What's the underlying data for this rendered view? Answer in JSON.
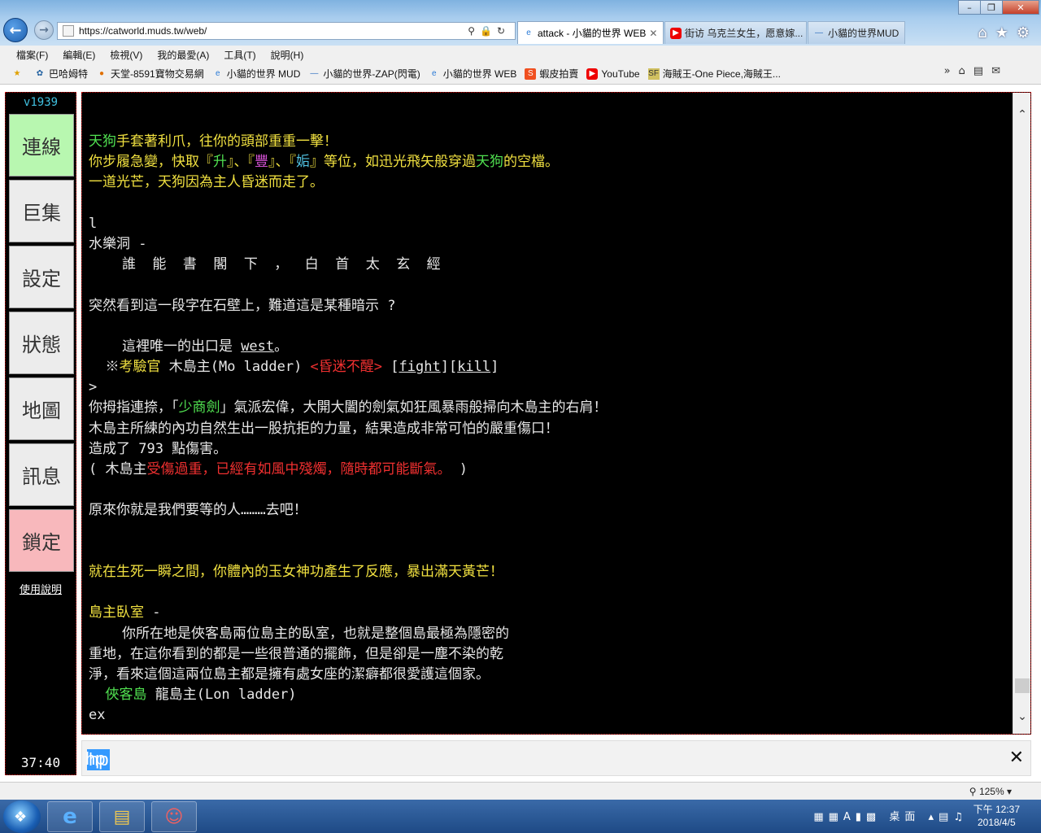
{
  "browser": {
    "url": "https://catworld.muds.tw/web/",
    "tabs": [
      {
        "label": "attack - 小貓的世界 WEB",
        "active": true
      },
      {
        "label": "街访 乌克兰女生，愿意嫁...",
        "active": false
      },
      {
        "label": "小貓的世界MUD",
        "active": false
      }
    ],
    "menu": [
      "檔案(F)",
      "編輯(E)",
      "檢視(V)",
      "我的最愛(A)",
      "工具(T)",
      "說明(H)"
    ],
    "favorites": [
      "巴哈姆特",
      "天堂-8591寶物交易網",
      "小貓的世界 MUD",
      "小貓的世界-ZAP(閃電)",
      "小貓的世界 WEB",
      "蝦皮拍賣",
      "YouTube",
      "海賊王-One Piece,海賊王..."
    ],
    "zoom": "125%"
  },
  "sidebar": {
    "version": "v1939",
    "buttons": [
      "連線",
      "巨集",
      "設定",
      "狀態",
      "地圖",
      "訊息",
      "鎖定"
    ],
    "help": "使用說明",
    "clock": "37:40"
  },
  "terminal": {
    "lines": [
      [
        {
          "t": "天狗",
          "c": "g"
        },
        {
          "t": "手套著利爪，往你的頭部重重一擊！",
          "c": "y"
        }
      ],
      [
        {
          "t": "你步履急變，快取『",
          "c": "y"
        },
        {
          "t": "升",
          "c": "g"
        },
        {
          "t": "』、『",
          "c": "y"
        },
        {
          "t": "豐",
          "c": "m"
        },
        {
          "t": "』、『",
          "c": "y"
        },
        {
          "t": "姤",
          "c": "c"
        },
        {
          "t": "』等位，如迅光飛矢般穿過",
          "c": "y"
        },
        {
          "t": "天狗",
          "c": "g"
        },
        {
          "t": "的空檔。",
          "c": "y"
        }
      ],
      [
        {
          "t": "一道光芒，天狗因為主人昏迷而走了。",
          "c": "y"
        }
      ],
      [],
      [
        {
          "t": "l",
          "c": "w"
        }
      ],
      [
        {
          "t": "水樂洞 -",
          "c": "w"
        }
      ],
      [
        {
          "t": "    誰  能  書  閣  下  ，  白  首  太  玄  經",
          "c": "w"
        }
      ],
      [],
      [
        {
          "t": "突然看到這一段字在石壁上，難道這是某種暗示 ?",
          "c": "w"
        }
      ],
      [],
      [
        {
          "t": "    這裡唯一的出口是 ",
          "c": "w"
        },
        {
          "t": "west",
          "c": "w",
          "u": true
        },
        {
          "t": "。",
          "c": "w"
        }
      ],
      [
        {
          "t": "  ※",
          "c": "w"
        },
        {
          "t": "考驗官",
          "c": "y"
        },
        {
          "t": " 木島主(Mo ladder) ",
          "c": "w"
        },
        {
          "t": "<昏迷不醒>",
          "c": "r"
        },
        {
          "t": " [",
          "c": "w"
        },
        {
          "t": "fight",
          "c": "w",
          "u": true
        },
        {
          "t": "][",
          "c": "w"
        },
        {
          "t": "kill",
          "c": "w",
          "u": true
        },
        {
          "t": "]",
          "c": "w"
        }
      ],
      [
        {
          "t": ">",
          "c": "w"
        }
      ],
      [
        {
          "t": "你拇指連捺，「",
          "c": "w"
        },
        {
          "t": "少商劍",
          "c": "g"
        },
        {
          "t": "」氣派宏偉，大開大闔的劍氣如狂風暴雨般掃向木島主的右肩！",
          "c": "w"
        }
      ],
      [
        {
          "t": "木島主所練的內功自然生出一股抗拒的力量，結果造成非常可怕的嚴重傷口！",
          "c": "w"
        }
      ],
      [
        {
          "t": "造成了 793 點傷害。",
          "c": "w"
        }
      ],
      [
        {
          "t": "( 木島主",
          "c": "w"
        },
        {
          "t": "受傷過重，已經有如風中殘燭，隨時都可能斷氣。",
          "c": "r"
        },
        {
          "t": " )",
          "c": "w"
        }
      ],
      [],
      [
        {
          "t": "原來你就是我們要等的人………去吧！",
          "c": "w"
        }
      ],
      [],
      [],
      [
        {
          "t": "就在生死一瞬之間，你體內的玉女神功產生了反應，暴出滿天黃芒！",
          "c": "y"
        }
      ],
      [],
      [
        {
          "t": "島主臥室",
          "c": "y"
        },
        {
          "t": " -",
          "c": "w"
        }
      ],
      [
        {
          "t": "    你所在地是俠客島兩位島主的臥室，也就是整個島最極為隱密的",
          "c": "w"
        }
      ],
      [
        {
          "t": "重地，在這你看到的都是一些很普通的擺飾，但是卻是一塵不染的乾",
          "c": "w"
        }
      ],
      [
        {
          "t": "淨，看來這個這兩位島主都是擁有處女座的潔癖都很愛護這個家。",
          "c": "w"
        }
      ],
      [
        {
          "t": "  ",
          "c": "w"
        },
        {
          "t": "俠客島",
          "c": "g"
        },
        {
          "t": " 龍島主(Lon ladder)",
          "c": "w"
        }
      ],
      [
        {
          "t": "ex",
          "c": "w"
        }
      ]
    ]
  },
  "input": {
    "value": "hp"
  },
  "taskbar": {
    "tray_label": "桌面",
    "time": "下午 12:37",
    "date": "2018/4/5"
  }
}
